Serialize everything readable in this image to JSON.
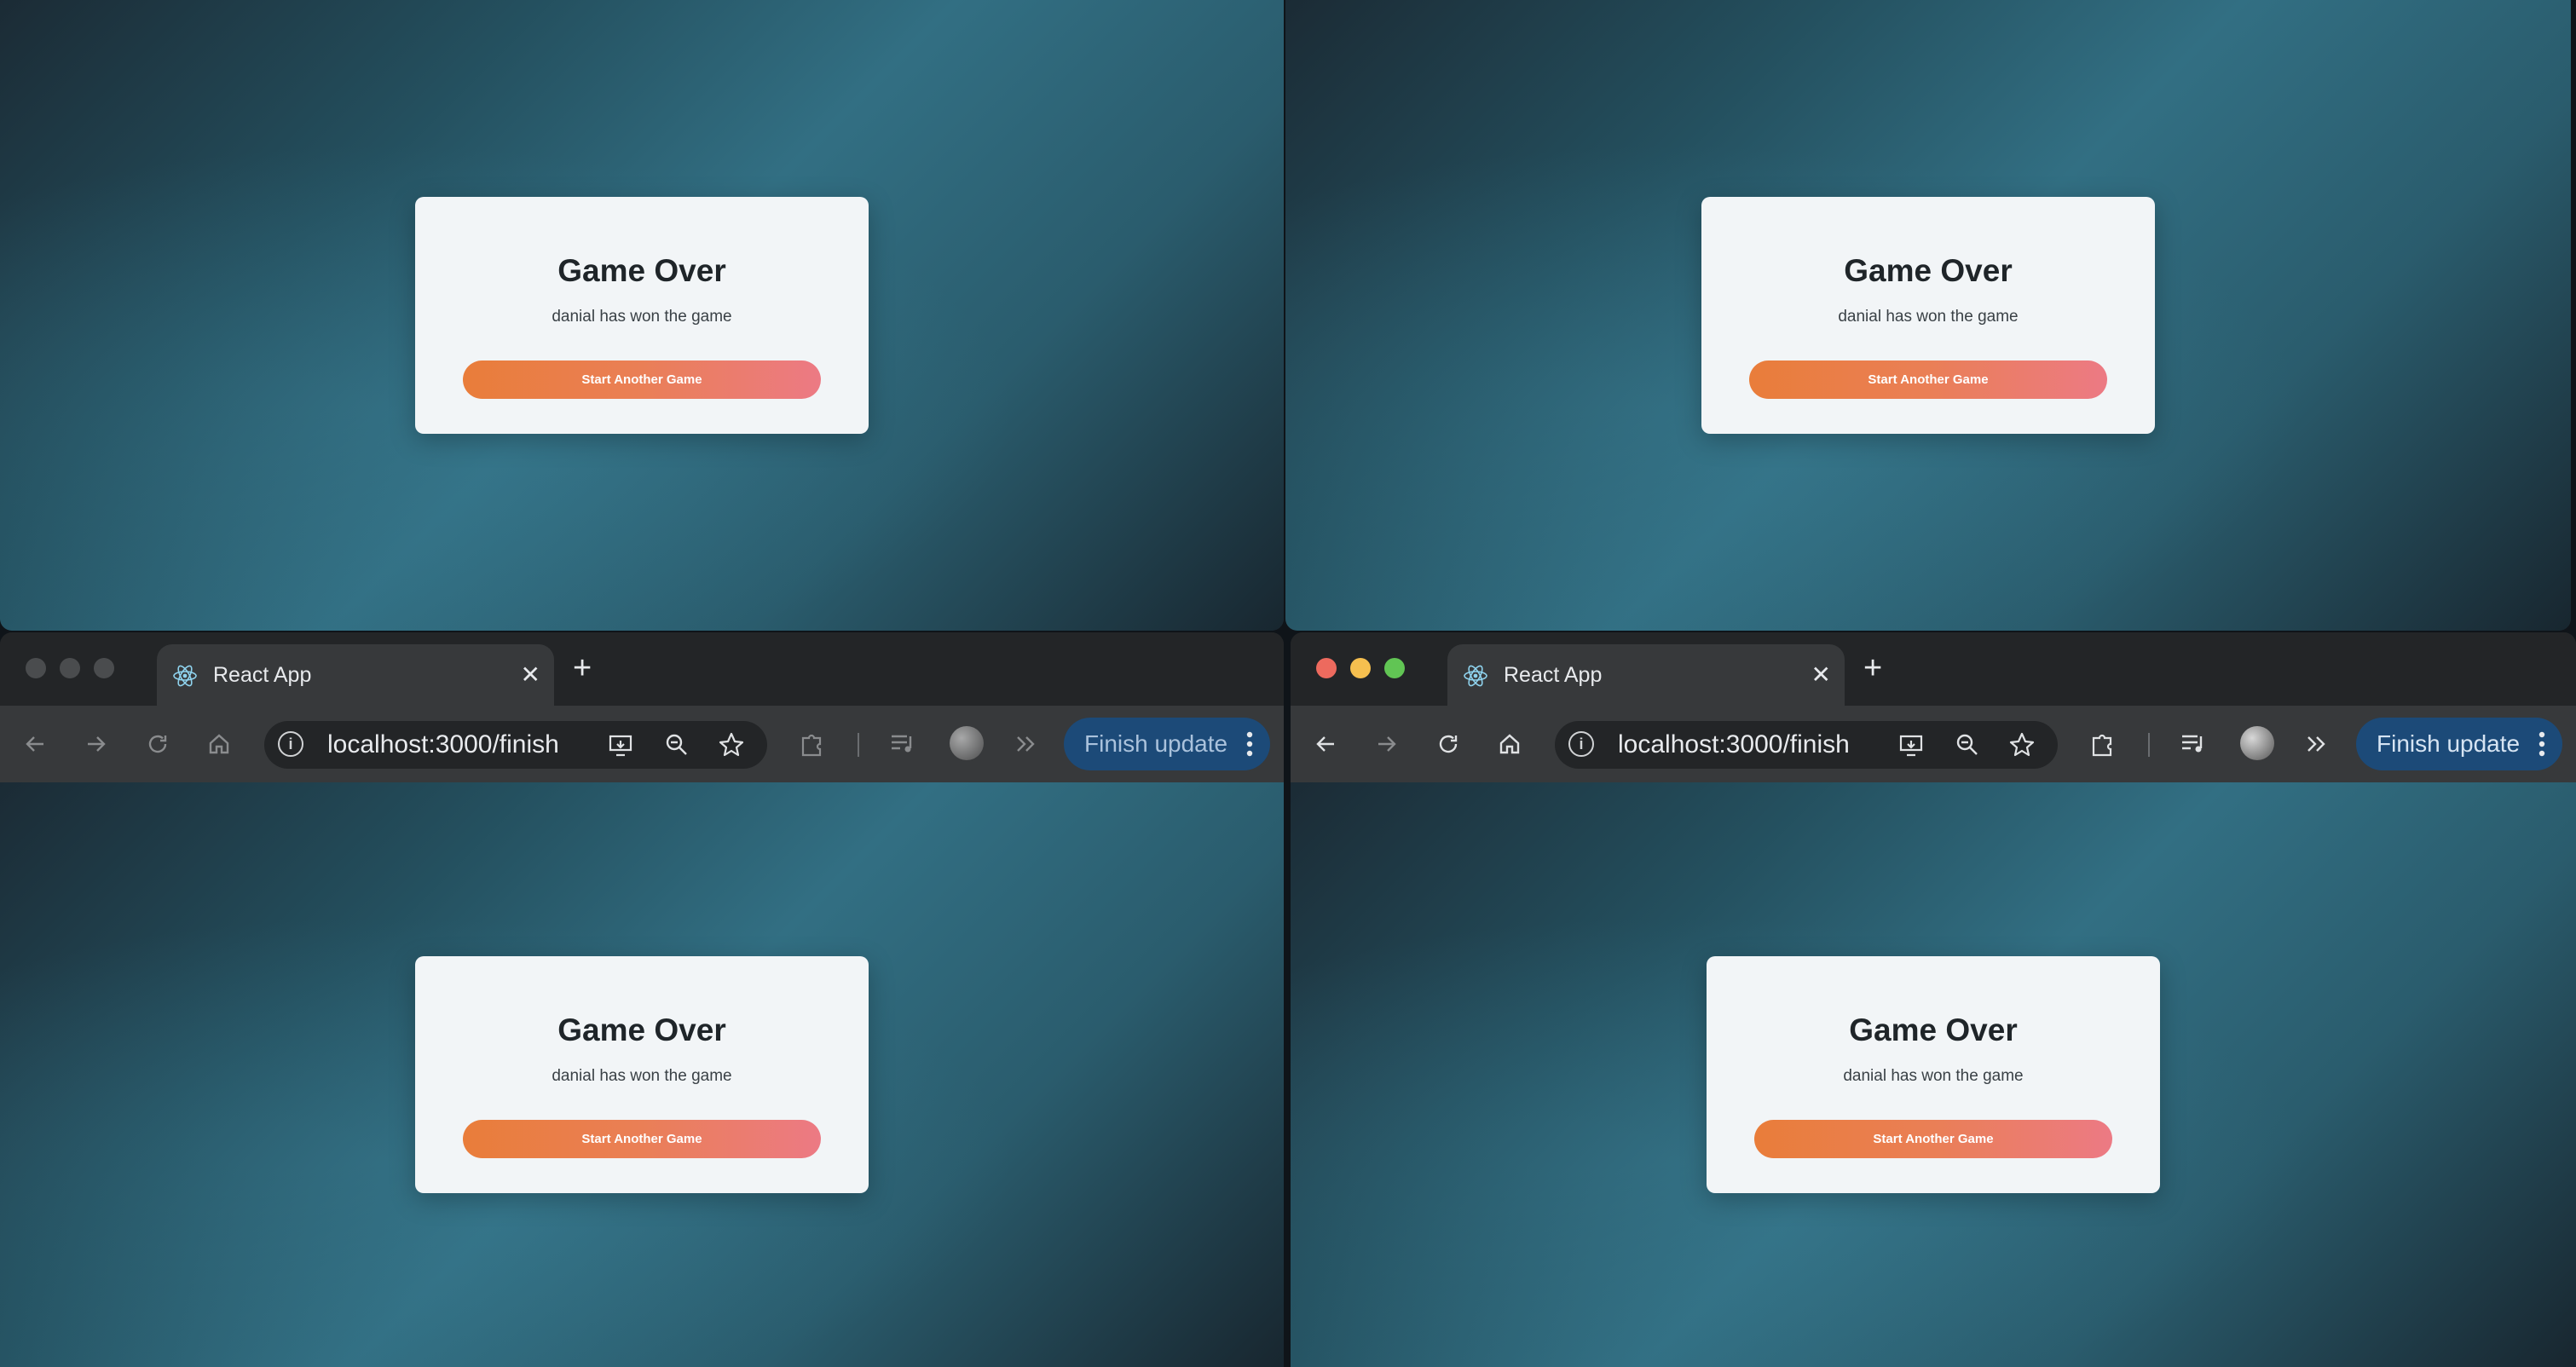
{
  "windows": [
    {
      "position": "top-left",
      "card": {
        "title": "Game Over",
        "message": "danial has won the game",
        "button": "Start Another Game"
      }
    },
    {
      "position": "top-right",
      "card": {
        "title": "Game Over",
        "message": "danial has won the game",
        "button": "Start Another Game"
      }
    },
    {
      "position": "bottom-left",
      "focused": false,
      "tab": {
        "title": "React App",
        "icon": "react-logo-icon"
      },
      "address": "localhost:3000/finish",
      "update_button": "Finish update",
      "card": {
        "title": "Game Over",
        "message": "danial has won the game",
        "button": "Start Another Game"
      }
    },
    {
      "position": "bottom-right",
      "focused": true,
      "tab": {
        "title": "React App",
        "icon": "react-logo-icon"
      },
      "address": "localhost:3000/finish",
      "update_button": "Finish update",
      "card": {
        "title": "Game Over",
        "message": "danial has won the game",
        "button": "Start Another Game"
      }
    }
  ],
  "colors": {
    "traffic_close": "#ed6a5e",
    "traffic_minimize": "#f5bf4f",
    "traffic_zoom": "#61c554",
    "traffic_inactive": "#4a4c4e",
    "button_gradient_start": "#e97d3a",
    "button_gradient_end": "#ec7a84",
    "update_button_bg": "#1c4a78"
  },
  "toolbar_icons": [
    "back-icon",
    "forward-icon",
    "reload-icon",
    "home-icon",
    "site-info-icon",
    "install-app-icon",
    "zoom-icon",
    "bookmark-star-icon",
    "extensions-icon",
    "media-controls-icon",
    "profile-avatar",
    "more-tabs-chevron-icon",
    "menu-dots-icon"
  ]
}
